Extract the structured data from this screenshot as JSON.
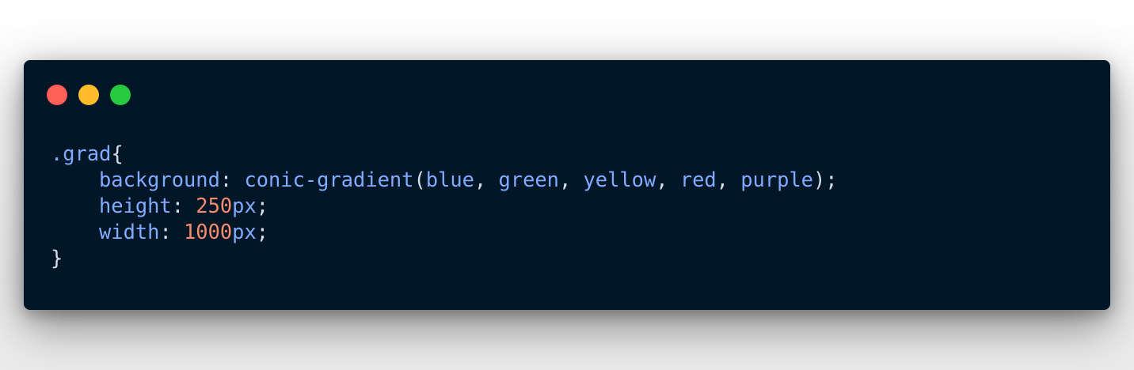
{
  "window": {
    "controls": [
      "close",
      "minimize",
      "maximize"
    ],
    "colors": {
      "background": "#011627",
      "close": "#ff5f56",
      "minimize": "#ffbd2e",
      "maximize": "#27c93f"
    }
  },
  "code": {
    "selector": ".grad",
    "open_brace": "{",
    "close_brace": "}",
    "background": {
      "property": "background",
      "function": "conic-gradient",
      "args": [
        "blue",
        "green",
        "yellow",
        "red",
        "purple"
      ]
    },
    "height": {
      "property": "height",
      "number": "250",
      "unit": "px"
    },
    "width": {
      "property": "width",
      "number": "1000",
      "unit": "px"
    },
    "syntax_colors": {
      "text": "#d6deeb",
      "identifier": "#82aaff",
      "number": "#f78c6c"
    }
  }
}
